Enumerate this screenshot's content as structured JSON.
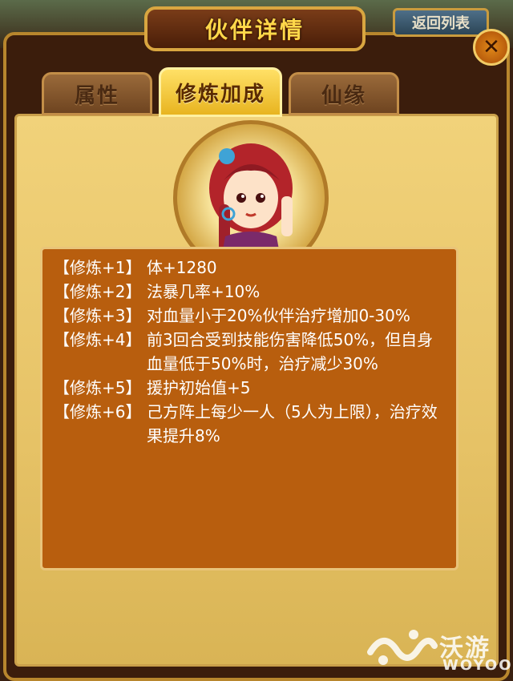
{
  "header": {
    "title": "伙伴详情",
    "return_label": "返回列表",
    "close_glyph": "✕"
  },
  "tabs": [
    {
      "label": "属性",
      "active": false
    },
    {
      "label": "修炼加成",
      "active": true
    },
    {
      "label": "仙缘",
      "active": false
    }
  ],
  "bonuses": [
    {
      "level": "【修炼+1】",
      "effect": "体+1280"
    },
    {
      "level": "【修炼+2】",
      "effect": "法暴几率+10%"
    },
    {
      "level": "【修炼+3】",
      "effect": "对血量小于20%伙伴治疗增加0-30%"
    },
    {
      "level": "【修炼+4】",
      "effect": "前3回合受到技能伤害降低50%，但自身血量低于50%时，治疗减少30%"
    },
    {
      "level": "【修炼+5】",
      "effect": "援护初始值+5"
    },
    {
      "level": "【修炼+6】",
      "effect": "己方阵上每少一人（5人为上限），治疗效果提升8%"
    }
  ],
  "watermark": {
    "text": "沃游",
    "sub": "WOYOO"
  },
  "colors": {
    "accent_gold": "#ffd84a",
    "panel": "#e6c266",
    "content_bg": "#b85e0e"
  }
}
